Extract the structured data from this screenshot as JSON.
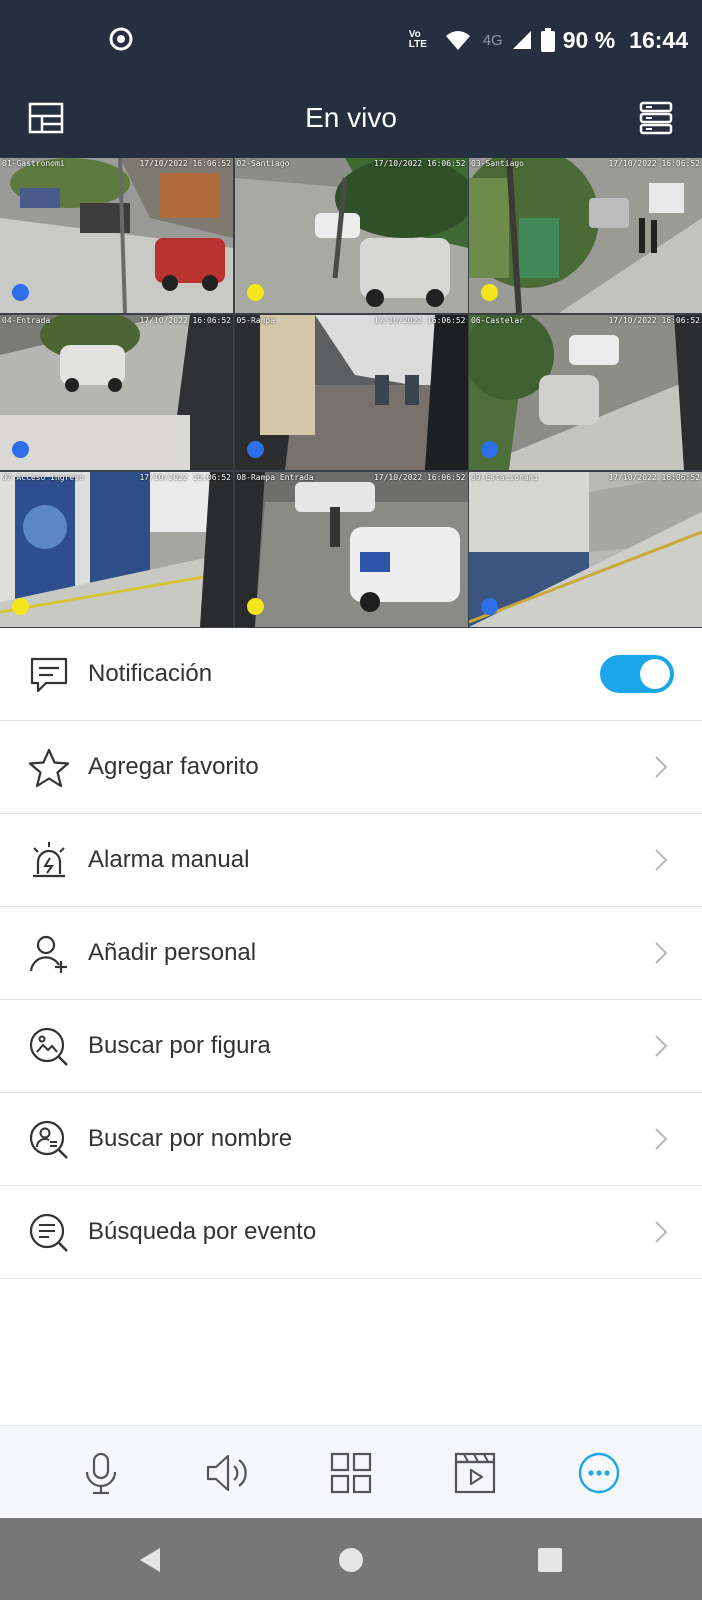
{
  "status_bar": {
    "volte": "Vo LTE",
    "network": "4G",
    "battery": "90 %",
    "time": "16:44"
  },
  "header": {
    "title": "En vivo",
    "left_icon": "layout-icon",
    "right_icon": "device-list-icon"
  },
  "cameras": [
    {
      "name": "01-Gastronomi",
      "timestamp": "17/10/2022 16:06:52",
      "status_color": "#2d6fe8",
      "selected": true
    },
    {
      "name": "02-Santiago",
      "timestamp": "17/10/2022 16:06:52",
      "status_color": "#f4e61b",
      "selected": false
    },
    {
      "name": "03-Santiago",
      "timestamp": "17/10/2022 16:06:52",
      "status_color": "#f4e61b",
      "selected": false
    },
    {
      "name": "04-Entrada",
      "timestamp": "17/10/2022 16:06:52",
      "status_color": "#2d6fe8",
      "selected": false
    },
    {
      "name": "05-Rampa",
      "timestamp": "17/10/2022 16:06:52",
      "status_color": "#2d6fe8",
      "selected": false
    },
    {
      "name": "06-Castelar",
      "timestamp": "17/10/2022 16:06:52",
      "status_color": "#2d6fe8",
      "selected": false
    },
    {
      "name": "07-Acceso Ingreso",
      "timestamp": "17/10/2022 16:06:52",
      "status_color": "#f4e61b",
      "selected": false
    },
    {
      "name": "08-Rampa Entrada",
      "timestamp": "17/10/2022 16:06:52",
      "status_color": "#f4e61b",
      "selected": false
    },
    {
      "name": "09-Estacionami",
      "timestamp": "17/10/2022 16:06:52",
      "status_color": "#2d6fe8",
      "selected": false
    }
  ],
  "menu": {
    "notification": {
      "label": "Notificación",
      "enabled": true
    },
    "items": [
      {
        "label": "Agregar favorito",
        "icon": "star-icon"
      },
      {
        "label": "Alarma manual",
        "icon": "alarm-siren-icon"
      },
      {
        "label": "Añadir personal",
        "icon": "add-person-icon"
      },
      {
        "label": "Buscar por figura",
        "icon": "search-by-image-icon"
      },
      {
        "label": "Buscar por nombre",
        "icon": "search-by-name-icon"
      },
      {
        "label": "Búsqueda por evento",
        "icon": "search-by-event-icon"
      }
    ]
  },
  "toolbar": {
    "items": [
      "microphone-icon",
      "speaker-icon",
      "grid-layout-icon",
      "playback-icon",
      "more-icon"
    ],
    "active": "more-icon",
    "accent": "#1aa6e8"
  },
  "colors": {
    "header_bg": "#262f40",
    "accent": "#1aa6e8",
    "status_blue": "#2d6fe8",
    "status_yellow": "#f4e61b"
  }
}
